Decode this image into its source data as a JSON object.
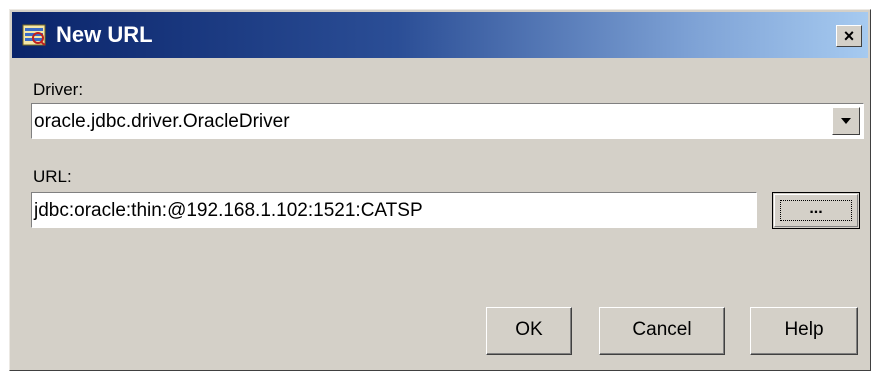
{
  "dialog": {
    "title": "New URL",
    "close_label": "×"
  },
  "driver": {
    "label": "Driver:",
    "selected": "oracle.jdbc.driver.OracleDriver"
  },
  "url": {
    "label": "URL:",
    "value": "jdbc:oracle:thin:@192.168.1.102:1521:CATSP",
    "browse_label": "..."
  },
  "buttons": {
    "ok": "OK",
    "cancel": "Cancel",
    "help": "Help"
  }
}
